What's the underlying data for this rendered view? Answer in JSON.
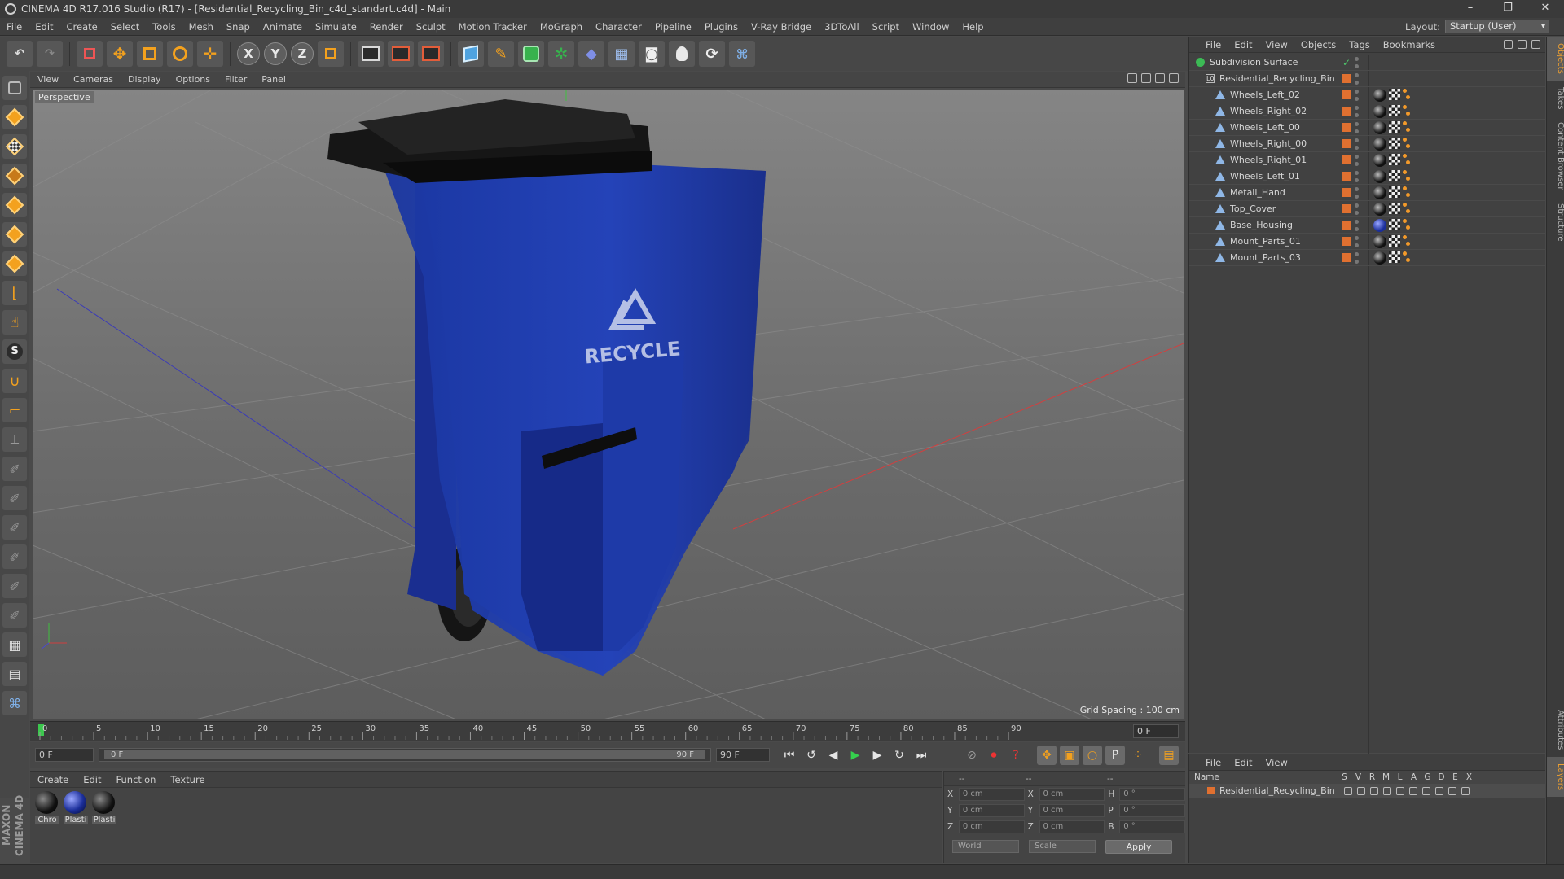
{
  "window": {
    "title": "CINEMA 4D R17.016 Studio (R17) - [Residential_Recycling_Bin_c4d_standart.c4d] - Main",
    "controls": [
      "–",
      "❐",
      "✕"
    ]
  },
  "menu": [
    "File",
    "Edit",
    "Create",
    "Select",
    "Tools",
    "Mesh",
    "Snap",
    "Animate",
    "Simulate",
    "Render",
    "Sculpt",
    "Motion Tracker",
    "MoGraph",
    "Character",
    "Pipeline",
    "Plugins",
    "V-Ray Bridge",
    "3DToAll",
    "Script",
    "Window",
    "Help"
  ],
  "layout": {
    "label": "Layout:",
    "value": "Startup (User)"
  },
  "toolbar": {
    "axes": [
      "X",
      "Y",
      "Z"
    ]
  },
  "viewport": {
    "menu": [
      "View",
      "Cameras",
      "Display",
      "Options",
      "Filter",
      "Panel"
    ],
    "label": "Perspective",
    "grid_spacing": "Grid Spacing : 100 cm",
    "bin_text": "RECYCLE",
    "colors": {
      "bin": "#1e3ea8",
      "lid": "#1c1c1c",
      "bg": "#7a7a7a"
    }
  },
  "timeline": {
    "ticks": [
      "0",
      "5",
      "10",
      "15",
      "20",
      "25",
      "30",
      "35",
      "40",
      "45",
      "50",
      "55",
      "60",
      "65",
      "70",
      "75",
      "80",
      "85",
      "90"
    ],
    "current_frame": "0 F",
    "start_field": "0 F",
    "range_start": "0 F",
    "range_end": "90 F",
    "end_field": "90 F"
  },
  "material_manager": {
    "menu": [
      "Create",
      "Edit",
      "Function",
      "Texture"
    ],
    "materials": [
      {
        "label": "Chro",
        "color": "dark"
      },
      {
        "label": "Plasti",
        "color": "blue"
      },
      {
        "label": "Plasti",
        "color": "dark"
      }
    ]
  },
  "coordinates": {
    "header": [
      "--",
      "--",
      "--"
    ],
    "rows": [
      {
        "a": "X",
        "av": "0 cm",
        "b": "X",
        "bv": "0 cm",
        "c": "H",
        "cv": "0 °"
      },
      {
        "a": "Y",
        "av": "0 cm",
        "b": "Y",
        "bv": "0 cm",
        "c": "P",
        "cv": "0 °"
      },
      {
        "a": "Z",
        "av": "0 cm",
        "b": "Z",
        "bv": "0 cm",
        "c": "B",
        "cv": "0 °"
      }
    ],
    "mode": "World",
    "scale": "Scale",
    "apply": "Apply"
  },
  "object_manager": {
    "menu": [
      "File",
      "Edit",
      "View",
      "Objects",
      "Tags",
      "Bookmarks"
    ],
    "items": [
      {
        "name": "Subdivision Surface",
        "type": "sub",
        "indent": 0
      },
      {
        "name": "Residential_Recycling_Bin",
        "type": "null",
        "indent": 1
      },
      {
        "name": "Wheels_Left_02",
        "type": "poly",
        "indent": 2,
        "mat": "dark"
      },
      {
        "name": "Wheels_Right_02",
        "type": "poly",
        "indent": 2,
        "mat": "dark"
      },
      {
        "name": "Wheels_Left_00",
        "type": "poly",
        "indent": 2,
        "mat": "dark"
      },
      {
        "name": "Wheels_Right_00",
        "type": "poly",
        "indent": 2,
        "mat": "dark"
      },
      {
        "name": "Wheels_Right_01",
        "type": "poly",
        "indent": 2,
        "mat": "dark"
      },
      {
        "name": "Wheels_Left_01",
        "type": "poly",
        "indent": 2,
        "mat": "dark"
      },
      {
        "name": "Metall_Hand",
        "type": "poly",
        "indent": 2,
        "mat": "dark"
      },
      {
        "name": "Top_Cover",
        "type": "poly",
        "indent": 2,
        "mat": "dark"
      },
      {
        "name": "Base_Housing",
        "type": "poly",
        "indent": 2,
        "mat": "blue"
      },
      {
        "name": "Mount_Parts_01",
        "type": "poly",
        "indent": 2,
        "mat": "dark"
      },
      {
        "name": "Mount_Parts_03",
        "type": "poly",
        "indent": 2,
        "mat": "dark"
      }
    ]
  },
  "layer_manager": {
    "menu": [
      "File",
      "Edit",
      "View"
    ],
    "columns": [
      "Name",
      "S",
      "V",
      "R",
      "M",
      "L",
      "A",
      "G",
      "D",
      "E",
      "X"
    ],
    "row": "Residential_Recycling_Bin"
  },
  "right_tabs": [
    "Objects",
    "Takes",
    "Content Browser",
    "Structure",
    "Attributes",
    "Layers"
  ],
  "brand": "MAXON CINEMA 4D"
}
